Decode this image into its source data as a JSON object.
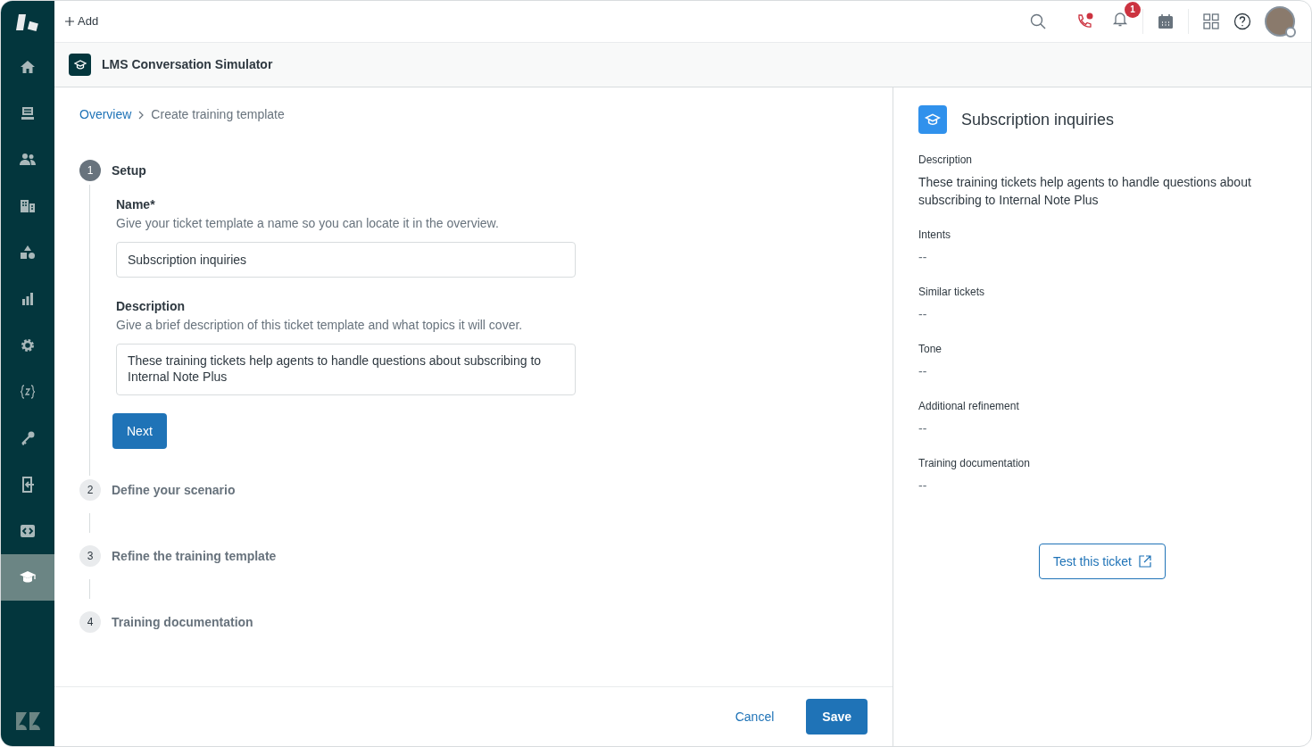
{
  "sidebar": {
    "items": [
      {
        "selected": false
      },
      {
        "selected": false
      },
      {
        "selected": false
      },
      {
        "selected": false
      },
      {
        "selected": false
      },
      {
        "selected": false
      },
      {
        "selected": false
      },
      {
        "selected": false
      },
      {
        "selected": false
      },
      {
        "selected": false
      },
      {
        "selected": false
      },
      {
        "selected": true
      }
    ]
  },
  "topbar": {
    "add_label": "Add",
    "notification_count": "1"
  },
  "app_header": {
    "title": "LMS Conversation Simulator"
  },
  "breadcrumb": {
    "link": "Overview",
    "current": "Create training template"
  },
  "steps": [
    {
      "number": "1",
      "title": "Setup",
      "selected": true
    },
    {
      "number": "2",
      "title": "Define your scenario",
      "selected": false
    },
    {
      "number": "3",
      "title": "Refine the training template",
      "selected": false
    },
    {
      "number": "4",
      "title": "Training documentation",
      "selected": false
    }
  ],
  "form": {
    "fields": [
      {
        "label": "Name*",
        "hint": "Give your ticket template a name so you can locate it in the overview.",
        "value": "Subscription inquiries",
        "kind": "input"
      },
      {
        "label": "Description",
        "hint": "Give a brief description of this ticket template and what topics it will cover.",
        "value": "These training tickets help agents to handle questions about subscribing to Internal Note Plus",
        "kind": "textarea"
      }
    ],
    "next_button": "Next"
  },
  "footer": {
    "cancel": "Cancel",
    "save": "Save"
  },
  "preview": {
    "title": "Subscription inquiries",
    "details": [
      {
        "label": "Description",
        "value": "These training tickets help agents to handle questions about subscribing to Internal Note Plus"
      },
      {
        "label": "Intents",
        "value": "--"
      },
      {
        "label": "Similar tickets",
        "value": "--"
      },
      {
        "label": "Tone",
        "value": "--"
      },
      {
        "label": "Additional refinement",
        "value": "--"
      },
      {
        "label": "Training documentation",
        "value": "--"
      }
    ],
    "test_button": "Test this ticket"
  }
}
